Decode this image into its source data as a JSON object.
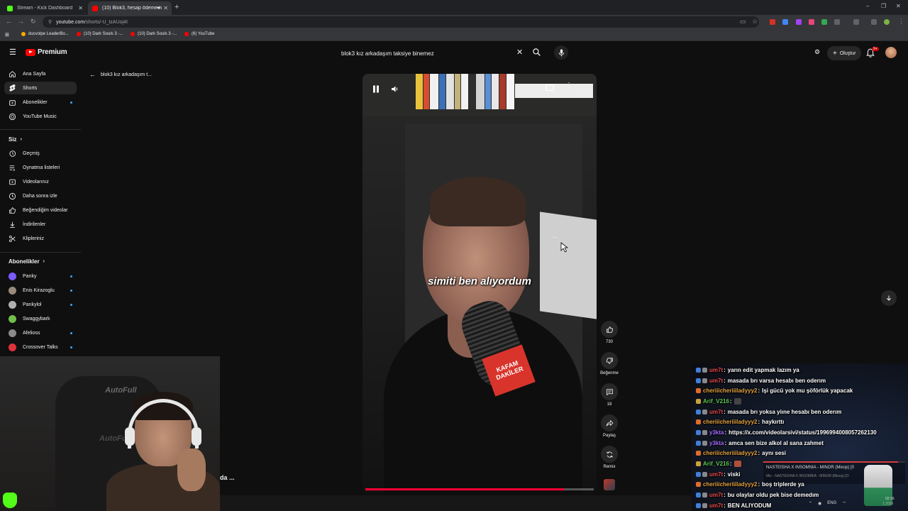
{
  "browser": {
    "tabs": [
      {
        "label": "Stream - Kick Dashboard",
        "favicon_color": "#53fc18",
        "active": false
      },
      {
        "label": "(10) Blok3, hesap ödeme n",
        "favicon_color": "#ff0000",
        "active": true
      }
    ],
    "url_host": "youtube.com",
    "url_path": "/shorts/-U_tzAUoj4I",
    "bookmarks": [
      {
        "label": "ducvolpe LeaderBo...",
        "color": "#f9ab00"
      },
      {
        "label": "(10) Dark Souls 3 -...",
        "color": "#ff0000"
      },
      {
        "label": "(10) Dark Souls 3 -...",
        "color": "#ff0000"
      },
      {
        "label": "(6) YouTube",
        "color": "#ff0000"
      }
    ]
  },
  "youtube": {
    "logo_text": "Premium",
    "search_query": "blok3 kız arkadaşım taksiye binemez",
    "create_label": "Oluştur",
    "notifications_badge": "9+"
  },
  "sidebar": {
    "main": [
      {
        "label": "Ana Sayfa",
        "icon": "home-icon"
      },
      {
        "label": "Shorts",
        "icon": "shorts-icon",
        "active": true
      },
      {
        "label": "Abonelikler",
        "icon": "subscriptions-icon",
        "dot": true
      },
      {
        "label": "YouTube Music",
        "icon": "music-icon"
      }
    ],
    "you_heading": "Siz",
    "you": [
      {
        "label": "Geçmiş",
        "icon": "history-icon"
      },
      {
        "label": "Oynatma listeleri",
        "icon": "playlists-icon"
      },
      {
        "label": "Videolarınız",
        "icon": "your-videos-icon"
      },
      {
        "label": "Daha sonra izle",
        "icon": "watch-later-icon"
      },
      {
        "label": "Beğendiğim videolar",
        "icon": "liked-icon"
      },
      {
        "label": "İndirilenler",
        "icon": "downloads-icon"
      },
      {
        "label": "Klipleriniz",
        "icon": "clips-icon"
      }
    ],
    "subs_heading": "Abonelikler",
    "channels": [
      {
        "label": "Panky",
        "color": "#7a5cff"
      },
      {
        "label": "Enis Kirazoglu",
        "color": "#9a8a7a"
      },
      {
        "label": "Pankylol",
        "color": "#b0b0b0"
      },
      {
        "label": "Swaggybark",
        "color": "#6fbf4a"
      },
      {
        "label": "Afelioss",
        "color": "#8a8a8a"
      },
      {
        "label": "Crossover Talks",
        "color": "#e0323a"
      }
    ]
  },
  "short": {
    "back_title": "blok3 kız arkadaşım t...",
    "caption": "simiti ben alıyordum",
    "mic_label_1": "KAFAM",
    "mic_label_2": "DAKİLER",
    "cc_label": "CC",
    "progress": 0.87
  },
  "actions": {
    "like_count": "730",
    "dislike_label": "Beğenme",
    "comments_count": "18",
    "share_label": "Paylaş",
    "remix_label": "Remix"
  },
  "stream": {
    "webcam_brand": "AutoFull",
    "truncated_text": "da ..."
  },
  "chat": [
    {
      "user": "um7t",
      "color": "#e84a4a",
      "msg": "yarın edit yapmak lazım ya",
      "badges": [
        "#3f7fd8",
        "#888888"
      ]
    },
    {
      "user": "um7t",
      "color": "#e84a4a",
      "msg": "masada brı varsa hesabı ben oderım",
      "badges": [
        "#3f7fd8",
        "#888888"
      ]
    },
    {
      "user": "cheriiicheriiiladyyy2",
      "color": "#e6a23c",
      "msg": "Işi gücü yok mu şöförlük yapacak",
      "badges": [
        "#e06b2b"
      ]
    },
    {
      "user": "Arif_V216",
      "color": "#5ec84f",
      "msg": "",
      "badges": [
        "#c9a33a"
      ],
      "emote": "#444444"
    },
    {
      "user": "um7t",
      "color": "#e84a4a",
      "msg": "masada brı yoksa yiıne hesabı ben oderım",
      "badges": [
        "#3f7fd8",
        "#888888"
      ]
    },
    {
      "user": "cheriiicheriiiladyyy2",
      "color": "#e6a23c",
      "msg": "haykırttı",
      "badges": [
        "#e06b2b"
      ]
    },
    {
      "user": "y3kta",
      "color": "#a46bff",
      "msg": "https://x.com/videolarsivi/status/1996994008057262130",
      "badges": [
        "#3f7fd8",
        "#888888"
      ]
    },
    {
      "user": "y3kta",
      "color": "#a46bff",
      "msg": "amca sen bize alkol al sana zahmet",
      "badges": [
        "#3f7fd8",
        "#888888"
      ]
    },
    {
      "user": "cheriiicheriiiladyyy2",
      "color": "#e6a23c",
      "msg": "aynı sesi",
      "badges": [
        "#e06b2b"
      ]
    },
    {
      "user": "Arif_V216",
      "color": "#5ec84f",
      "msg": "",
      "badges": [
        "#c9a33a"
      ],
      "emote": "#b0503a"
    },
    {
      "user": "um7t",
      "color": "#e84a4a",
      "msg": "viski",
      "badges": [
        "#3f7fd8",
        "#888888"
      ]
    },
    {
      "user": "cheriiicheriiiladyyy2",
      "color": "#e6a23c",
      "msg": "boş triplerde ya",
      "badges": [
        "#e06b2b"
      ]
    },
    {
      "user": "um7t",
      "color": "#e84a4a",
      "msg": "bu olaylar oldu pek bise demedım",
      "badges": [
        "#3f7fd8",
        "#888888"
      ]
    },
    {
      "user": "um7t",
      "color": "#e84a4a",
      "msg": "BEN ALIYODUM",
      "badges": [
        "#3f7fd8",
        "#888888"
      ]
    }
  ],
  "now_playing": {
    "title": "NASTEISHA X INSOMNIA - MINOR (Mixop) [0",
    "subtitle": "Mix - NASTEISHA X INSOMNIA - MINOR (Mixop) [O",
    "progress": 0.95
  },
  "taskbar": {
    "lang": "ENG",
    "time": "02:16",
    "date": "1.2026"
  }
}
